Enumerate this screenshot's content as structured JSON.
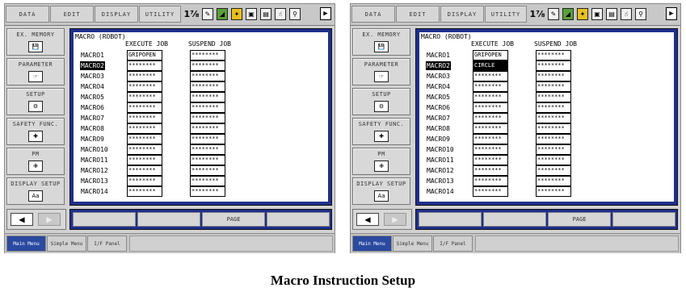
{
  "panels": [
    {
      "menu": [
        "DATA",
        "EDIT",
        "DISPLAY",
        "UTILITY"
      ],
      "sidebar": [
        {
          "label": "EX. MEMORY",
          "icon": "disk-icon"
        },
        {
          "label": "PARAMETER",
          "icon": "hand-pointer-icon"
        },
        {
          "label": "SETUP",
          "icon": "setup-icon"
        },
        {
          "label": "SAFETY FUNC.",
          "icon": "safety-cross-icon"
        },
        {
          "label": "PM",
          "icon": "medical-kit-icon"
        },
        {
          "label": "DISPLAY SETUP",
          "icon": "display-font-icon"
        }
      ],
      "screen": {
        "title": "MACRO (ROBOT)",
        "col_execute": "EXECUTE JOB",
        "col_suspend": "SUSPEND JOB",
        "rows": [
          {
            "name": "MACRO1",
            "execute": "GRIPOPEN",
            "suspend": "********"
          },
          {
            "name": "MACRO2",
            "execute": "********",
            "suspend": "********"
          },
          {
            "name": "MACRO3",
            "execute": "********",
            "suspend": "********"
          },
          {
            "name": "MACRO4",
            "execute": "********",
            "suspend": "********"
          },
          {
            "name": "MACRO5",
            "execute": "********",
            "suspend": "********"
          },
          {
            "name": "MACRO6",
            "execute": "********",
            "suspend": "********"
          },
          {
            "name": "MACRO7",
            "execute": "********",
            "suspend": "********"
          },
          {
            "name": "MACRO8",
            "execute": "********",
            "suspend": "********"
          },
          {
            "name": "MACRO9",
            "execute": "********",
            "suspend": "********"
          },
          {
            "name": "MACRO10",
            "execute": "********",
            "suspend": "********"
          },
          {
            "name": "MACRO11",
            "execute": "********",
            "suspend": "********"
          },
          {
            "name": "MACRO12",
            "execute": "********",
            "suspend": "********"
          },
          {
            "name": "MACRO13",
            "execute": "********",
            "suspend": "********"
          },
          {
            "name": "MACRO14",
            "execute": "********",
            "suspend": "********"
          }
        ]
      },
      "fkeys": [
        "",
        "",
        "PAGE",
        ""
      ],
      "bottom_tabs": [
        "Main Menu",
        "Simple Menu",
        "I/F Panel"
      ]
    },
    {
      "menu": [
        "DATA",
        "EDIT",
        "DISPLAY",
        "UTILITY"
      ],
      "sidebar": [
        {
          "label": "EX. MEMORY",
          "icon": "disk-icon"
        },
        {
          "label": "PARAMETER",
          "icon": "hand-pointer-icon"
        },
        {
          "label": "SETUP",
          "icon": "setup-icon"
        },
        {
          "label": "SAFETY FUNC.",
          "icon": "safety-cross-icon"
        },
        {
          "label": "PM",
          "icon": "medical-kit-icon"
        },
        {
          "label": "DISPLAY SETUP",
          "icon": "display-font-icon"
        }
      ],
      "screen": {
        "title": "MACRO (ROBOT)",
        "col_execute": "EXECUTE JOB",
        "col_suspend": "SUSPEND JOB",
        "rows": [
          {
            "name": "MACRO1",
            "execute": "GRIPOPEN",
            "suspend": "********"
          },
          {
            "name": "MACRO2",
            "execute": "CIRCLE",
            "suspend": "********"
          },
          {
            "name": "MACRO3",
            "execute": "********",
            "suspend": "********"
          },
          {
            "name": "MACRO4",
            "execute": "********",
            "suspend": "********"
          },
          {
            "name": "MACRO5",
            "execute": "********",
            "suspend": "********"
          },
          {
            "name": "MACRO6",
            "execute": "********",
            "suspend": "********"
          },
          {
            "name": "MACRO7",
            "execute": "********",
            "suspend": "********"
          },
          {
            "name": "MACRO8",
            "execute": "********",
            "suspend": "********"
          },
          {
            "name": "MACRO9",
            "execute": "********",
            "suspend": "********"
          },
          {
            "name": "MACRO10",
            "execute": "********",
            "suspend": "********"
          },
          {
            "name": "MACRO11",
            "execute": "********",
            "suspend": "********"
          },
          {
            "name": "MACRO12",
            "execute": "********",
            "suspend": "********"
          },
          {
            "name": "MACRO13",
            "execute": "********",
            "suspend": "********"
          },
          {
            "name": "MACRO14",
            "execute": "********",
            "suspend": "********"
          }
        ]
      },
      "fkeys": [
        "",
        "",
        "PAGE",
        ""
      ],
      "bottom_tabs": [
        "Main Menu",
        "Simple Menu",
        "I/F Panel"
      ]
    }
  ],
  "caption": "Macro Instruction Setup",
  "colors": {
    "screen_frame": "#1e2f8c",
    "active_tab": "#2a4aa0",
    "panel_bg": "#d2d2d2"
  }
}
